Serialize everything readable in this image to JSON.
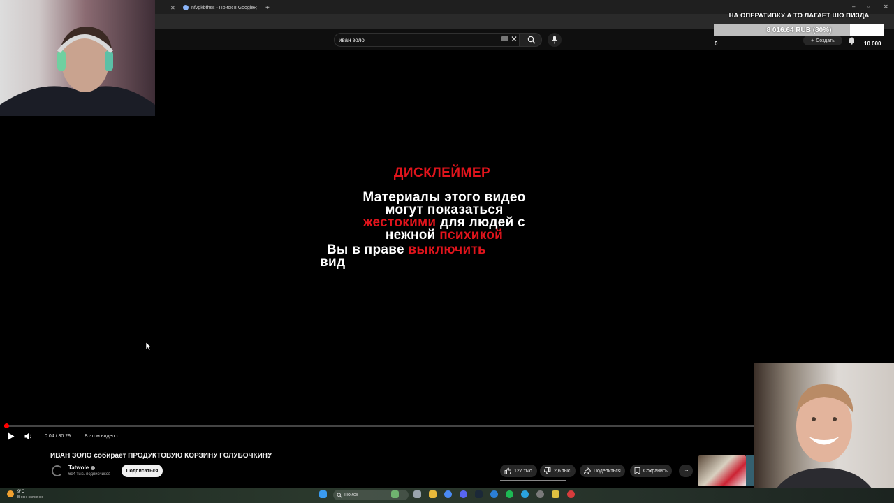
{
  "browser": {
    "tabs": [
      {
        "label": "nfvgkbfhss - Поиск в Google"
      }
    ],
    "new_tab": "+"
  },
  "youtube": {
    "search": {
      "value": "иван золо"
    },
    "create_label": "Создать"
  },
  "donation": {
    "title": "НА ОПЕРАТИВКУ А ТО ЛАГАЕТ ШО ПИЗДА",
    "progress_text": "8 016.64 RUB (80%)",
    "progress_fraction": 0.8,
    "min": "0",
    "max": "10 000"
  },
  "video": {
    "disclaimer_title": "ДИСКЛЕЙМЕР",
    "line1": "Материалы этого видео",
    "line2": "могут показаться",
    "line3_red": "жестокими",
    "line3_white": " для людей с",
    "line4_white": "нежной ",
    "line4_red": "психикой",
    "line5_white": "Вы в праве ",
    "line5_red": "выключить",
    "line6": "вид",
    "played_fraction": 0.002
  },
  "player": {
    "time": "0:04 / 30:29",
    "chapter": "В этом видео ›"
  },
  "info": {
    "title": "ИВАН ЗОЛО собирает ПРОДУКТОВУЮ КОРЗИНУ ГОЛУБОЧКИНУ",
    "channel_name": "Tatwole",
    "subscribers": "694 тыс. подписчиков",
    "subscribe_label": "Подписаться",
    "likes": "127 тыс.",
    "dislikes": "2,6 тыс.",
    "share_label": "Поделиться",
    "save_label": "Сохранить"
  },
  "taskbar": {
    "temperature": "9°C",
    "weather": "В осн. солнечно",
    "search_placeholder": "Поиск"
  },
  "colors": {
    "accent_red": "#e0141c",
    "youtube_red": "#ff0000"
  }
}
